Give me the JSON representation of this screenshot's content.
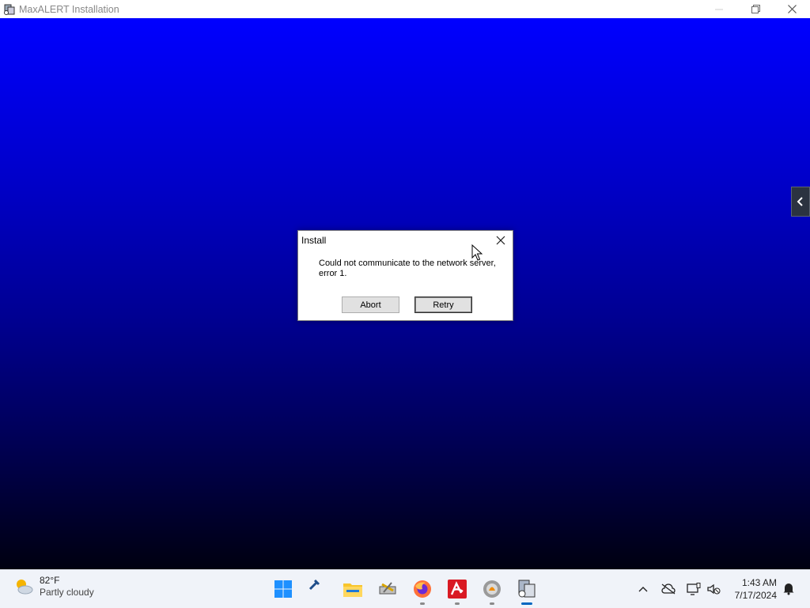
{
  "window": {
    "title": "MaxALERT Installation"
  },
  "dialog": {
    "title": "Install",
    "message_line1": "Could not communicate to the network server,",
    "message_line2": "error 1.",
    "abort_label": "Abort",
    "retry_label": "Retry"
  },
  "taskbar": {
    "weather_temp": "82°F",
    "weather_condition": "Partly cloudy",
    "time": "1:43 AM",
    "date": "7/17/2024",
    "apps": [
      "start-icon",
      "tools-icon",
      "file-explorer-icon",
      "disk-tool-icon",
      "firefox-icon",
      "avira-icon",
      "setup-icon",
      "installer-icon"
    ]
  },
  "colors": {
    "background_top": "#0000ff",
    "background_bottom": "#000010",
    "accent": "#0067c0"
  }
}
